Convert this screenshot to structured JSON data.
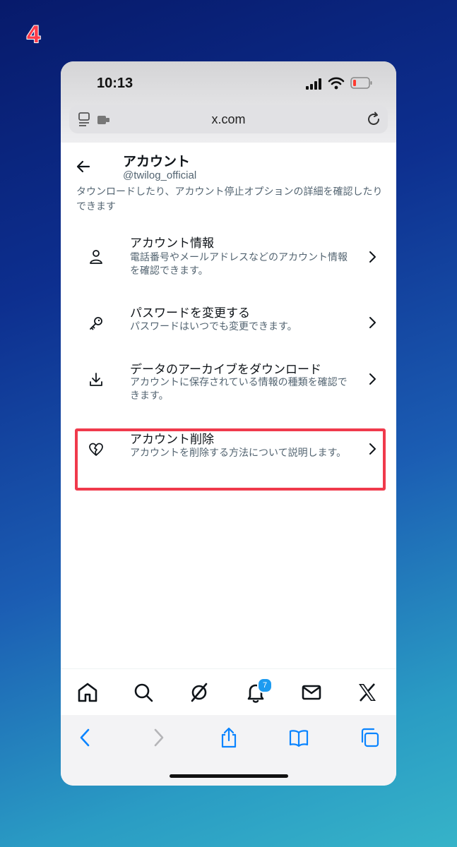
{
  "step_number": "4",
  "status_bar": {
    "time": "10:13"
  },
  "browser": {
    "url": "x.com"
  },
  "header": {
    "title": "アカウント",
    "handle": "@twilog_official",
    "description": "タウンロードしたり、アカウント停止オプションの詳細を確認したりできます"
  },
  "items": [
    {
      "label": "アカウント情報",
      "subtitle": "電話番号やメールアドレスなどのアカウント情報を確認できます。",
      "icon": "person-icon"
    },
    {
      "label": "パスワードを変更する",
      "subtitle": "パスワードはいつでも変更できます。",
      "icon": "key-icon"
    },
    {
      "label": "データのアーカイブをダウンロード",
      "subtitle": "アカウントに保存されている情報の種類を確認できます。",
      "icon": "download-icon",
      "highlighted": true
    },
    {
      "label": "アカウント削除",
      "subtitle": "アカウントを削除する方法について説明します。",
      "icon": "broken-heart-icon"
    }
  ],
  "bottom_nav": {
    "notifications_badge": "7",
    "icons": [
      "home-icon",
      "search-icon",
      "grok-icon",
      "bell-icon",
      "mail-icon",
      "x-logo-icon"
    ]
  },
  "safari_toolbar": {
    "icons": [
      "back-icon",
      "forward-icon",
      "share-icon",
      "bookmarks-icon",
      "tabs-icon"
    ]
  },
  "colors": {
    "highlight": "#f03a4c",
    "accent_blue": "#1d9bf0",
    "safari_blue": "#0a84ff",
    "text_primary": "#0f1419",
    "text_secondary": "#536471"
  }
}
